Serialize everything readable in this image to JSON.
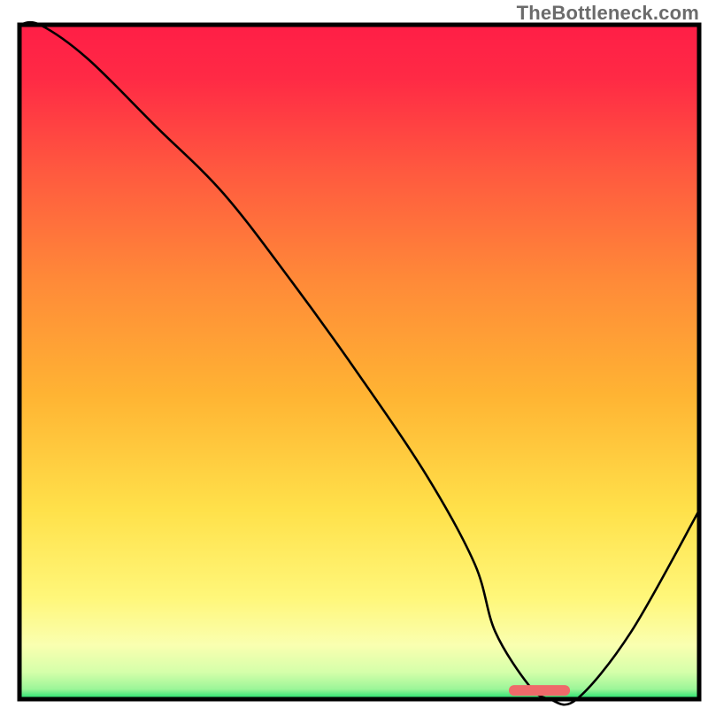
{
  "watermark": "TheBottleneck.com",
  "chart_data": {
    "type": "line",
    "title": "",
    "xlabel": "",
    "ylabel": "",
    "xlim": [
      0,
      100
    ],
    "ylim": [
      0,
      100
    ],
    "series": [
      {
        "name": "curve",
        "x": [
          0,
          3,
          10,
          20,
          30,
          40,
          50,
          60,
          67,
          70,
          75,
          78,
          82,
          90,
          100
        ],
        "values": [
          100,
          100,
          95,
          85,
          75,
          62,
          48,
          33,
          20,
          10,
          2,
          0,
          0,
          10,
          28
        ]
      }
    ],
    "gradient_stops": [
      {
        "offset": 0,
        "color": "#ff1e46"
      },
      {
        "offset": 0.08,
        "color": "#ff2a45"
      },
      {
        "offset": 0.22,
        "color": "#ff5a3f"
      },
      {
        "offset": 0.38,
        "color": "#ff8a38"
      },
      {
        "offset": 0.55,
        "color": "#ffb433"
      },
      {
        "offset": 0.72,
        "color": "#ffe14a"
      },
      {
        "offset": 0.85,
        "color": "#fff77a"
      },
      {
        "offset": 0.92,
        "color": "#faffb0"
      },
      {
        "offset": 0.96,
        "color": "#d5ffaa"
      },
      {
        "offset": 0.985,
        "color": "#9cf598"
      },
      {
        "offset": 1.0,
        "color": "#1adf6c"
      }
    ],
    "marker": {
      "x_start": 72,
      "x_end": 81,
      "y": 1.3,
      "color": "#ef6a6a"
    },
    "frame_color": "#000000"
  }
}
